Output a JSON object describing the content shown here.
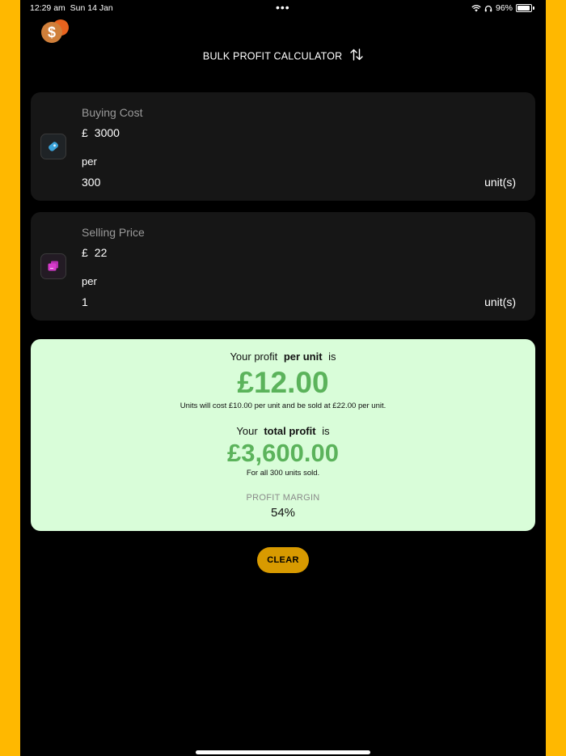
{
  "status_bar": {
    "time": "12:29 am",
    "date": "Sun 14 Jan",
    "multitask_dots": "•••",
    "battery_percent": "96%"
  },
  "header": {
    "title": "BULK PROFIT CALCULATOR",
    "swap_icon": "swap-vertical-icon"
  },
  "buying": {
    "label": "Buying Cost",
    "currency": "£",
    "amount": "3000",
    "per_label": "per",
    "quantity": "300",
    "unit_label": "unit(s)",
    "icon": "tag-icon",
    "icon_color": "#3BA3D9"
  },
  "selling": {
    "label": "Selling Price",
    "currency": "£",
    "amount": "22",
    "per_label": "per",
    "quantity": "1",
    "unit_label": "unit(s)",
    "icon": "sale-icon",
    "icon_color": "#D63BCB"
  },
  "result": {
    "per_unit_prefix": "Your profit",
    "per_unit_emph": "per unit",
    "per_unit_suffix": "is",
    "per_unit_value": "£12.00",
    "per_unit_note": "Units will cost £10.00 per unit and be sold at £22.00 per unit.",
    "total_prefix": "Your",
    "total_emph": "total profit",
    "total_suffix": "is",
    "total_value": "£3,600.00",
    "total_note": "For all 300 units sold.",
    "margin_label": "PROFIT MARGIN",
    "margin_value": "54%",
    "accent_color": "#5BB35B",
    "background_color": "#D9FDD9"
  },
  "actions": {
    "clear_label": "CLEAR",
    "clear_color": "#D89A00"
  }
}
